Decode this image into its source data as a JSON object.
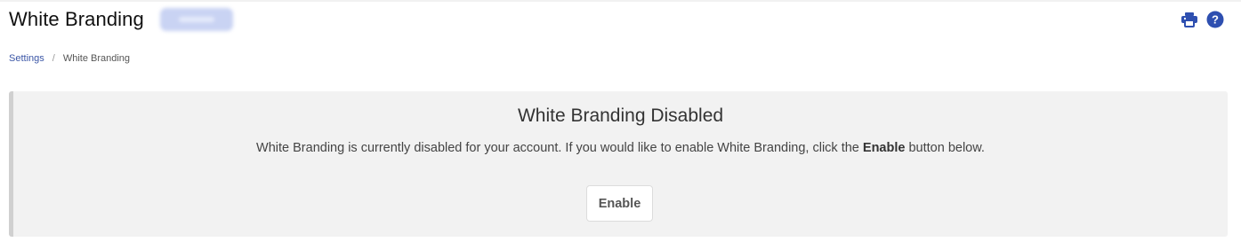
{
  "header": {
    "title": "White Branding",
    "actions": [
      {
        "icon": "printer-icon",
        "label": "Print"
      },
      {
        "icon": "help-icon",
        "label": "Help"
      }
    ]
  },
  "breadcrumb": {
    "items": [
      {
        "label": "Settings",
        "link": true
      },
      {
        "label": "White Branding",
        "link": false
      }
    ],
    "separator": "/"
  },
  "notice": {
    "heading": "White Branding Disabled",
    "message_before": "White Branding is currently disabled for your account. If you would like to enable White Branding, click the ",
    "message_emphasis": "Enable",
    "message_after": " button below.",
    "button_label": "Enable"
  },
  "colors": {
    "accent": "#2e4fb0",
    "link": "#3b56a6",
    "panel_background": "#f2f2f2",
    "panel_border": "#d0d0d0"
  }
}
